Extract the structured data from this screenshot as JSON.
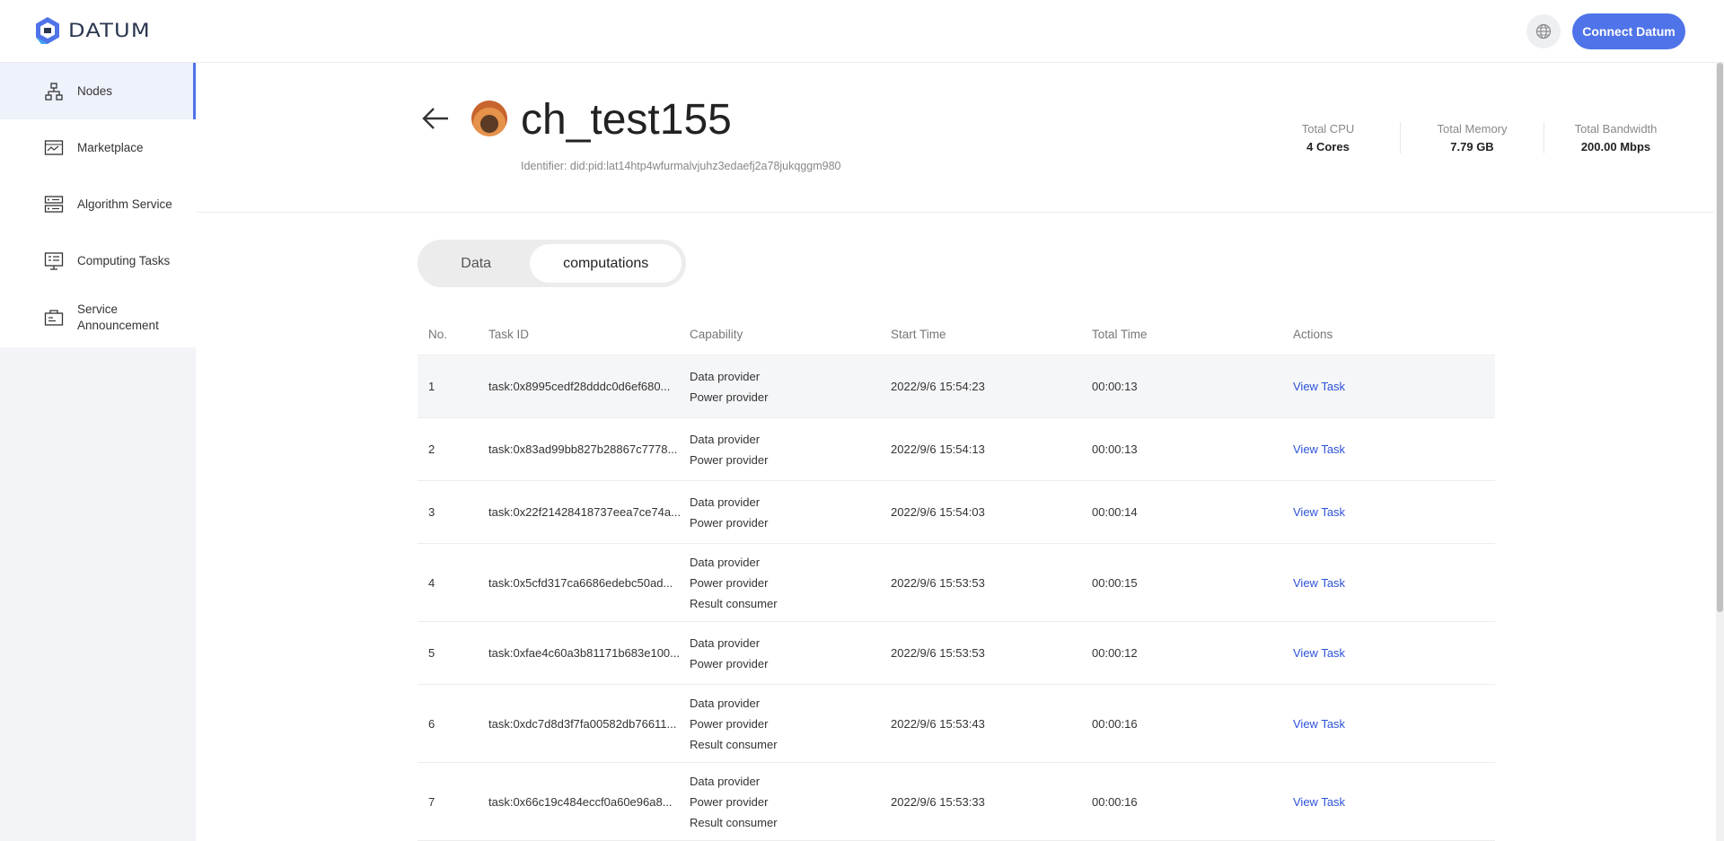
{
  "app": {
    "logo_text": "DATUM",
    "connect_label": "Connect Datum"
  },
  "sidebar": {
    "items": [
      {
        "label": "Nodes",
        "icon": "nodes-icon",
        "active": true
      },
      {
        "label": "Marketplace",
        "icon": "marketplace-icon"
      },
      {
        "label": "Algorithm Service",
        "icon": "algorithm-icon"
      },
      {
        "label": "Computing Tasks",
        "icon": "tasks-icon"
      },
      {
        "label": "Service Announcement",
        "icon": "announcement-icon"
      }
    ]
  },
  "node": {
    "name": "ch_test155",
    "identifier_label": "Identifier:",
    "identifier_value": "did:pid:lat14htp4wfurmalvjuhz3edaefj2a78jukqggm980",
    "stats": [
      {
        "label": "Total CPU",
        "value": "4 Cores"
      },
      {
        "label": "Total Memory",
        "value": "7.79 GB"
      },
      {
        "label": "Total Bandwidth",
        "value": "200.00 Mbps"
      }
    ]
  },
  "tabs": {
    "data": "Data",
    "computations": "computations",
    "active": "computations"
  },
  "table": {
    "headers": {
      "no": "No.",
      "task_id": "Task ID",
      "capability": "Capability",
      "start_time": "Start Time",
      "total_time": "Total Time",
      "actions": "Actions"
    },
    "rows": [
      {
        "no": "1",
        "task_id": "task:0x8995cedf28dddc0d6ef680...",
        "capability": [
          "Data provider",
          "Power provider"
        ],
        "start": "2022/9/6 15:54:23",
        "total": "00:00:13",
        "action": "View Task"
      },
      {
        "no": "2",
        "task_id": "task:0x83ad99bb827b28867c7778...",
        "capability": [
          "Data provider",
          "Power provider"
        ],
        "start": "2022/9/6 15:54:13",
        "total": "00:00:13",
        "action": "View Task"
      },
      {
        "no": "3",
        "task_id": "task:0x22f21428418737eea7ce74a...",
        "capability": [
          "Data provider",
          "Power provider"
        ],
        "start": "2022/9/6 15:54:03",
        "total": "00:00:14",
        "action": "View Task"
      },
      {
        "no": "4",
        "task_id": "task:0x5cfd317ca6686edebc50ad...",
        "capability": [
          "Data provider",
          "Power provider",
          "Result consumer"
        ],
        "start": "2022/9/6 15:53:53",
        "total": "00:00:15",
        "action": "View Task"
      },
      {
        "no": "5",
        "task_id": "task:0xfae4c60a3b81171b683e100...",
        "capability": [
          "Data provider",
          "Power provider"
        ],
        "start": "2022/9/6 15:53:53",
        "total": "00:00:12",
        "action": "View Task"
      },
      {
        "no": "6",
        "task_id": "task:0xdc7d8d3f7fa00582db76611...",
        "capability": [
          "Data provider",
          "Power provider",
          "Result consumer"
        ],
        "start": "2022/9/6 15:53:43",
        "total": "00:00:16",
        "action": "View Task"
      },
      {
        "no": "7",
        "task_id": "task:0x66c19c484eccf0a60e96a8...",
        "capability": [
          "Data provider",
          "Power provider",
          "Result consumer"
        ],
        "start": "2022/9/6 15:53:33",
        "total": "00:00:16",
        "action": "View Task"
      }
    ]
  }
}
